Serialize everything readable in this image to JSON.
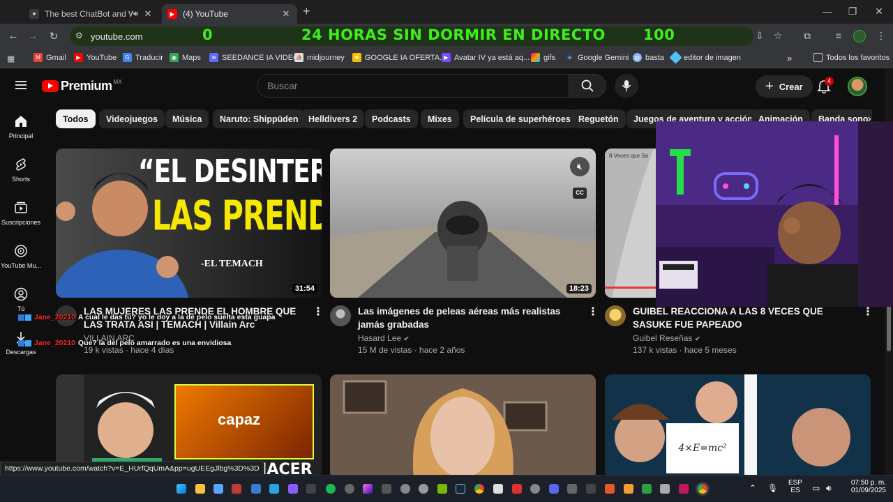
{
  "browser": {
    "tabs": [
      {
        "title": "The best ChatBot and Widg",
        "active": false
      },
      {
        "title": "(4) YouTube",
        "active": true
      }
    ],
    "new_tab_label": "+",
    "window_controls": {
      "minimize": "—",
      "maximize": "❐",
      "close": "✕"
    },
    "url": "youtube.com",
    "banner": {
      "left": "0",
      "center": "24 HORAS SIN DORMIR EN DIRECTO",
      "right": "100"
    },
    "bookmarks": [
      {
        "label": "Gmail",
        "color": "#ea4335"
      },
      {
        "label": "YouTube",
        "color": "#ff0000"
      },
      {
        "label": "Traducir",
        "color": "#4285f4"
      },
      {
        "label": "Maps",
        "color": "#34a853"
      },
      {
        "label": "SEEDANCE IA VIDEO",
        "color": "#5f6bff"
      },
      {
        "label": "midjourney",
        "color": "#dddddd"
      },
      {
        "label": "GOOGLE IA OFERTA...",
        "color": "#fbbc04"
      },
      {
        "label": "Avatar IV ya está aq...",
        "color": "#7a4dff"
      },
      {
        "label": "gifs",
        "color": "#ff9a00"
      },
      {
        "label": "Google Gemini",
        "color": "#4b8cf7"
      },
      {
        "label": "basta",
        "color": "#8ab4f8"
      },
      {
        "label": "editor de imagen",
        "color": "#4fc3f7"
      }
    ],
    "bookmarks_more": "»",
    "all_bookmarks": "Todos los favoritos",
    "status_url": "https://www.youtube.com/watch?v=E_HUrfQqUmA&pp=ugUEEgJlbg%3D%3D"
  },
  "youtube": {
    "logo_text": "Premium",
    "country": "MX",
    "search_placeholder": "Buscar",
    "create_label": "Crear",
    "notifications": "4",
    "sidebar": [
      {
        "label": "Principal"
      },
      {
        "label": "Shorts"
      },
      {
        "label": "Suscripciones"
      },
      {
        "label": "YouTube Mu..."
      },
      {
        "label": "Tú"
      },
      {
        "label": "Descargas"
      }
    ],
    "chips": [
      "Todos",
      "Videojuegos",
      "Música",
      "Naruto: Shippūden",
      "Helldivers 2",
      "Podcasts",
      "Mixes",
      "Película de superhéroes",
      "Reguetón",
      "Juegos de aventura y acción",
      "Animación",
      "Banda sono"
    ],
    "videos": [
      {
        "title": "LAS MUJERES LAS PRENDE EL HOMBRE QUE LAS TRATA ASI | TEMACH | Villain Arc",
        "channel": "VILLAIN ARC",
        "meta": "19 k vistas · hace 4 días",
        "duration": "31:54",
        "thumb_text_1": "“EL DESINTERÉS",
        "thumb_text_2": "LAS PRENDE”",
        "thumb_text_3": "-EL TEMACH"
      },
      {
        "title": "Las imágenes de peleas aéreas más realistas jamás grabadas",
        "channel": "Hasard Lee",
        "meta": "15 M de vistas · hace 2 años",
        "duration": "18:23",
        "cc": "CC"
      },
      {
        "title": "GUIBEL REACCIONA A LAS 8 VECES QUE SASUKE FUE PAPEADO",
        "channel": "Guibel Reseñas",
        "meta": "137 k vistas · hace 5 meses",
        "thumb_label": "8 Veces que Sa"
      }
    ],
    "row2": {
      "thumb1_overlay": "capaz",
      "thumb1_text": "HACER",
      "thumb3_board": "4×E=mc²"
    }
  },
  "chat": [
    {
      "user": "Jane_20210",
      "text": "A cual le das tu? yo le doy a la de pelo suelta esta guapa"
    },
    {
      "user": "Jane_20210",
      "text": "Que? la del pelo amarrado es una envidiosa"
    }
  ],
  "taskbar": {
    "lang_1": "ESP",
    "lang_2": "ES",
    "time": "07:50 p. m.",
    "date": "01/09/2025"
  }
}
